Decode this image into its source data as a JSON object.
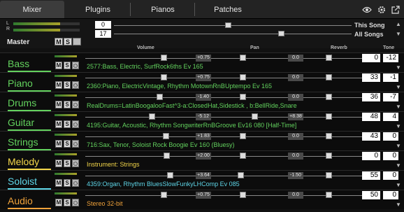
{
  "tabs": [
    {
      "label": "Mixer",
      "active": true
    },
    {
      "label": "Plugins"
    },
    {
      "label": "Pianos"
    },
    {
      "label": "Patches"
    }
  ],
  "master": {
    "value1": "0",
    "value2": "17",
    "this_song": "This Song",
    "all_songs": "All Songs",
    "label": "Master",
    "m": "M",
    "s": "S"
  },
  "headers": {
    "volume": "Volume",
    "pan": "Pan",
    "reverb": "Reverb",
    "tone": "Tone"
  },
  "channels": [
    {
      "name": "Bass",
      "color": "#63d25e",
      "vol": "+0.75",
      "pan": "0.0",
      "reverb": "0",
      "tone": "-12",
      "patch": "2577:Bass, Electric, SurfRock6ths Ev 165"
    },
    {
      "name": "Piano",
      "color": "#63d25e",
      "vol": "+0.75",
      "pan": "0.0",
      "reverb": "33",
      "tone": "-1",
      "patch": "2360:Piano, ElectricVintage, Rhythm MotownRnBUptempo Ev 165"
    },
    {
      "name": "Drums",
      "color": "#63d25e",
      "vol": "-1.40",
      "pan": "0.0",
      "reverb": "36",
      "tone": "-7",
      "patch": "RealDrums=LatinBoogalooFast^3-a:ClosedHat,Sidestick , b:BellRide,Snare"
    },
    {
      "name": "Guitar",
      "color": "#63d25e",
      "vol": "-5.12",
      "pan": "+8.38",
      "reverb": "48",
      "tone": "4",
      "patch": "4195:Guitar, Acoustic, Rhythm SongwriterRnBGroove Ev16 080 [Half-Time]"
    },
    {
      "name": "Strings",
      "color": "#63d25e",
      "vol": "+1.83",
      "pan": "0.0",
      "reverb": "43",
      "tone": "0",
      "patch": "716:Sax, Tenor, Soloist Rock Boogie Ev 160 (Bluesy)"
    },
    {
      "name": "Melody",
      "color": "#f3d64a",
      "vol": "+2.00",
      "pan": "0.0",
      "reverb": "0",
      "tone": "0",
      "patch": "Instrument: Strings"
    },
    {
      "name": "Soloist",
      "color": "#5fd6e8",
      "vol": "+3.64",
      "pan": "-1.50",
      "reverb": "55",
      "tone": "0",
      "patch": "4359:Organ, Rhythm BluesSlowFunkyLHComp Ev 085"
    },
    {
      "name": "Audio",
      "color": "#f0a23a",
      "vol": "+0.75",
      "pan": "0.0",
      "reverb": "50",
      "tone": "0",
      "patch": "Stereo 32-bit"
    }
  ],
  "row_buttons": {
    "m": "M",
    "s": "S",
    "fx": "fx"
  },
  "icons": [
    "eye-icon",
    "gear-icon",
    "popout-icon",
    "arrow-up-icon",
    "arrow-down-icon"
  ]
}
